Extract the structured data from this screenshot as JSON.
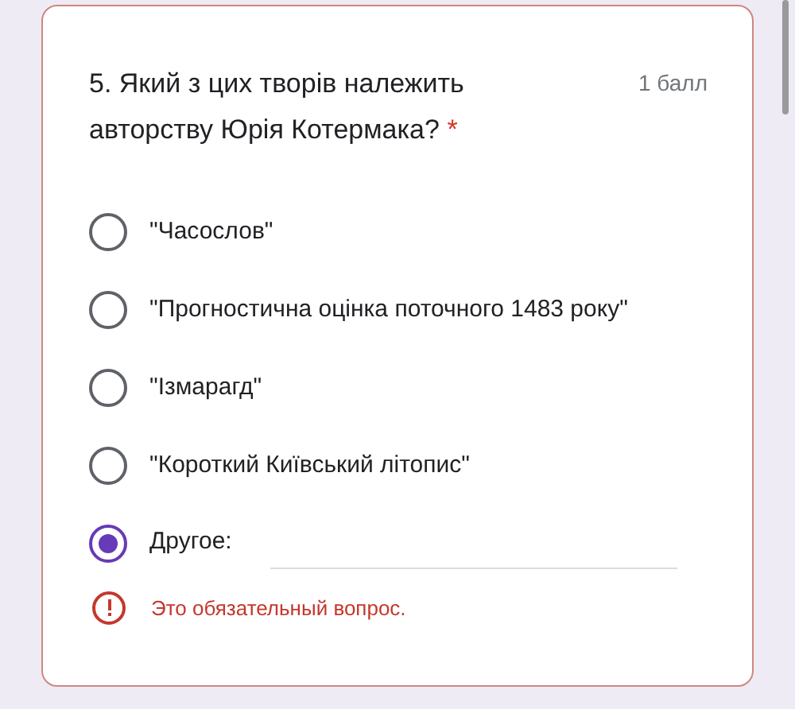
{
  "question": {
    "title": "5. Який з цих творів належить авторству Юрія Котермака?",
    "required_mark": "*",
    "points": "1 балл"
  },
  "options": [
    {
      "kind": "choice",
      "label": "\"Часослов\"",
      "selected": false
    },
    {
      "kind": "choice",
      "label": "\"Прогностична оцінка поточного 1483 року\"",
      "selected": false
    },
    {
      "kind": "choice",
      "label": "\"Ізмарагд\"",
      "selected": false
    },
    {
      "kind": "choice",
      "label": "\"Короткий Київський літопис\"",
      "selected": false
    },
    {
      "kind": "other",
      "label": "Другое:",
      "selected": true
    }
  ],
  "error": "Это обязательный вопрос."
}
